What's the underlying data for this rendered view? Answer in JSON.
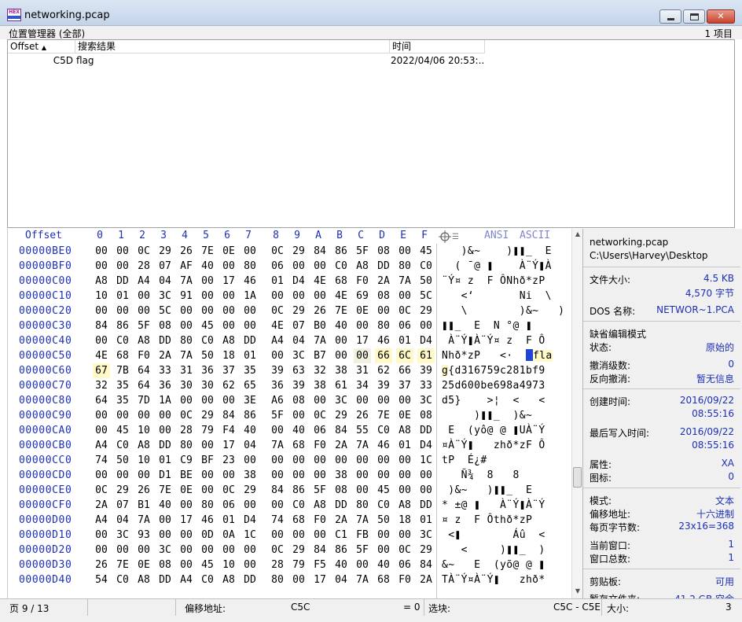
{
  "window": {
    "title": "networking.pcap",
    "icon": "hex-editor-app-icon",
    "icon_text": "HEX"
  },
  "position_manager": {
    "title": "位置管理器 (全部)",
    "count": "1 项目",
    "columns": {
      "offset": "Offset",
      "result": "搜索结果",
      "time": "时间"
    },
    "rows": [
      {
        "offset": "C5D",
        "result": "flag",
        "time": "2022/04/06  20:53:..."
      }
    ]
  },
  "hex": {
    "ruler": {
      "offset_label": "Offset",
      "columns": [
        "0",
        "1",
        "2",
        "3",
        "4",
        "5",
        "6",
        "7",
        "8",
        "9",
        "A",
        "B",
        "C",
        "D",
        "E",
        "F"
      ],
      "ansi": "ANSI",
      "ascii": "ASCII"
    },
    "rows": [
      {
        "off": "00000BE0",
        "bytes": [
          "00",
          "00",
          "0C",
          "29",
          "26",
          "7E",
          "0E",
          "00",
          "0C",
          "29",
          "84",
          "86",
          "5F",
          "08",
          "00",
          "45"
        ],
        "text": "   )&~    )❚❚_  E"
      },
      {
        "off": "00000BF0",
        "bytes": [
          "00",
          "00",
          "28",
          "07",
          "AF",
          "40",
          "00",
          "80",
          "06",
          "00",
          "00",
          "C0",
          "A8",
          "DD",
          "80",
          "C0"
        ],
        "text": "  ( ¯@ ❚    À¨Ý❚À"
      },
      {
        "off": "00000C00",
        "bytes": [
          "A8",
          "DD",
          "A4",
          "04",
          "7A",
          "00",
          "17",
          "46",
          "01",
          "D4",
          "4E",
          "68",
          "F0",
          "2A",
          "7A",
          "50"
        ],
        "text": "¨Ý¤ z  F ÔNhð*zP"
      },
      {
        "off": "00000C10",
        "bytes": [
          "10",
          "01",
          "00",
          "3C",
          "91",
          "00",
          "00",
          "1A",
          "00",
          "00",
          "00",
          "4E",
          "69",
          "08",
          "00",
          "5C"
        ],
        "text": "   <‘       Ni  \\"
      },
      {
        "off": "00000C20",
        "bytes": [
          "00",
          "00",
          "00",
          "5C",
          "00",
          "00",
          "00",
          "00",
          "0C",
          "29",
          "26",
          "7E",
          "0E",
          "00",
          "0C",
          "29"
        ],
        "text": "   \\        )&~   )"
      },
      {
        "off": "00000C30",
        "bytes": [
          "84",
          "86",
          "5F",
          "08",
          "00",
          "45",
          "00",
          "00",
          "4E",
          "07",
          "B0",
          "40",
          "00",
          "80",
          "06",
          "00"
        ],
        "text": "❚❚_  E  N °@ ❚  "
      },
      {
        "off": "00000C40",
        "bytes": [
          "00",
          "C0",
          "A8",
          "DD",
          "80",
          "C0",
          "A8",
          "DD",
          "A4",
          "04",
          "7A",
          "00",
          "17",
          "46",
          "01",
          "D4"
        ],
        "text": " À¨Ý❚À¨Ý¤ z  F Ô"
      },
      {
        "off": "00000C50",
        "bytes": [
          "4E",
          "68",
          "F0",
          "2A",
          "7A",
          "50",
          "18",
          "01",
          "00",
          "3C",
          "B7",
          "00",
          "00",
          "66",
          "6C",
          "61"
        ],
        "text_pre": "Nhð*zP   <·  ",
        "text_cur": " ",
        "text_hl": "fla"
      },
      {
        "off": "00000C60",
        "bytes": [
          "67",
          "7B",
          "64",
          "33",
          "31",
          "36",
          "37",
          "35",
          "39",
          "63",
          "32",
          "38",
          "31",
          "62",
          "66",
          "39"
        ],
        "text_hl_first": "g",
        "text": "{d316759c281bf9"
      },
      {
        "off": "00000C70",
        "bytes": [
          "32",
          "35",
          "64",
          "36",
          "30",
          "30",
          "62",
          "65",
          "36",
          "39",
          "38",
          "61",
          "34",
          "39",
          "37",
          "33"
        ],
        "text": "25d600be698a4973"
      },
      {
        "off": "00000C80",
        "bytes": [
          "64",
          "35",
          "7D",
          "1A",
          "00",
          "00",
          "00",
          "3E",
          "A6",
          "08",
          "00",
          "3C",
          "00",
          "00",
          "00",
          "3C"
        ],
        "text": "d5}    >¦  <   <"
      },
      {
        "off": "00000C90",
        "bytes": [
          "00",
          "00",
          "00",
          "00",
          "0C",
          "29",
          "84",
          "86",
          "5F",
          "00",
          "0C",
          "29",
          "26",
          "7E",
          "0E",
          "08"
        ],
        "text": "     )❚❚_  )&~  "
      },
      {
        "off": "00000CA0",
        "bytes": [
          "00",
          "45",
          "10",
          "00",
          "28",
          "79",
          "F4",
          "40",
          "00",
          "40",
          "06",
          "84",
          "55",
          "C0",
          "A8",
          "DD"
        ],
        "text": " E  (yô@ @ ❚UÀ¨Ý"
      },
      {
        "off": "00000CB0",
        "bytes": [
          "A4",
          "C0",
          "A8",
          "DD",
          "80",
          "00",
          "17",
          "04",
          "7A",
          "68",
          "F0",
          "2A",
          "7A",
          "46",
          "01",
          "D4"
        ],
        "text": "¤À¨Ý❚   zhð*zF Ô"
      },
      {
        "off": "00000CC0",
        "bytes": [
          "74",
          "50",
          "10",
          "01",
          "C9",
          "BF",
          "23",
          "00",
          "00",
          "00",
          "00",
          "00",
          "00",
          "00",
          "00",
          "1C"
        ],
        "text": "tP  É¿#         "
      },
      {
        "off": "00000CD0",
        "bytes": [
          "00",
          "00",
          "00",
          "D1",
          "BE",
          "00",
          "00",
          "38",
          "00",
          "00",
          "00",
          "38",
          "00",
          "00",
          "00",
          "00"
        ],
        "text": "   Ñ¾  8   8    "
      },
      {
        "off": "00000CE0",
        "bytes": [
          "0C",
          "29",
          "26",
          "7E",
          "0E",
          "00",
          "0C",
          "29",
          "84",
          "86",
          "5F",
          "08",
          "00",
          "45",
          "00",
          "00"
        ],
        "text": " )&~   )❚❚_  E  "
      },
      {
        "off": "00000CF0",
        "bytes": [
          "2A",
          "07",
          "B1",
          "40",
          "00",
          "80",
          "06",
          "00",
          "00",
          "C0",
          "A8",
          "DD",
          "80",
          "C0",
          "A8",
          "DD"
        ],
        "text": "* ±@ ❚   À¨Ý❚À¨Ý"
      },
      {
        "off": "00000D00",
        "bytes": [
          "A4",
          "04",
          "7A",
          "00",
          "17",
          "46",
          "01",
          "D4",
          "74",
          "68",
          "F0",
          "2A",
          "7A",
          "50",
          "18",
          "01"
        ],
        "text": "¤ z  F Ôthð*zP  "
      },
      {
        "off": "00000D10",
        "bytes": [
          "00",
          "3C",
          "93",
          "00",
          "00",
          "0D",
          "0A",
          "1C",
          "00",
          "00",
          "00",
          "C1",
          "FB",
          "00",
          "00",
          "3C"
        ],
        "text": " <❚        Áû  <"
      },
      {
        "off": "00000D20",
        "bytes": [
          "00",
          "00",
          "00",
          "3C",
          "00",
          "00",
          "00",
          "00",
          "0C",
          "29",
          "84",
          "86",
          "5F",
          "00",
          "0C",
          "29"
        ],
        "text": "   <     )❚❚_  )"
      },
      {
        "off": "00000D30",
        "bytes": [
          "26",
          "7E",
          "0E",
          "08",
          "00",
          "45",
          "10",
          "00",
          "28",
          "79",
          "F5",
          "40",
          "00",
          "40",
          "06",
          "84"
        ],
        "text": "&~   E  (yõ@ @ ❚"
      },
      {
        "off": "00000D40",
        "bytes": [
          "54",
          "C0",
          "A8",
          "DD",
          "A4",
          "C0",
          "A8",
          "DD",
          "80",
          "00",
          "17",
          "04",
          "7A",
          "68",
          "F0",
          "2A"
        ],
        "text": "TÀ¨Ý¤À¨Ý❚   zhð*"
      }
    ]
  },
  "info": {
    "file_name": "networking.pcap",
    "file_path": "C:\\Users\\Harvey\\Desktop",
    "size_label": "文件大小:",
    "size_kb": "4.5 KB",
    "size_bytes": "4,570 字节",
    "dos_label": "DOS 名称:",
    "dos_value": "NETWOR~1.PCA",
    "edit_mode_title": "缺省编辑模式",
    "state_label": "状态:",
    "state_value": "原始的",
    "undo_label": "撤消级数:",
    "undo_value": "0",
    "redo_label": "反向撤消:",
    "redo_value": "暂无信息",
    "created_label": "创建时间:",
    "created_date": "2016/09/22",
    "created_time": "08:55:16",
    "written_label": "最后写入时间:",
    "written_date": "2016/09/22",
    "written_time": "08:55:16",
    "attr_label": "属性:",
    "attr_value": "XA",
    "icon_label": "图标:",
    "icon_value": "0",
    "mode_label": "模式:",
    "mode_value": "文本",
    "offset_addr_label": "偏移地址:",
    "offset_addr_value": "十六进制",
    "bpp_label": "每页字节数:",
    "bpp_value": "23x16=368",
    "cur_win_label": "当前窗口:",
    "cur_win_value": "1",
    "total_win_label": "窗口总数:",
    "total_win_value": "1",
    "clipboard_label": "剪贴板:",
    "clipboard_value": "可用",
    "temp_label": "暂存文件夹:",
    "temp_value": "41.2 GB 空余"
  },
  "status": {
    "page": "页 9 / 13",
    "offset_label": "偏移地址:",
    "offset_value": "C5C",
    "eq_value": "= 0",
    "block_label": "选块:",
    "block_value": "C5C - C5E",
    "size_label": "大小:",
    "size_value": "3"
  },
  "colors": {
    "offset_blue": "#1c2fb5",
    "highlight": "#fff9c7",
    "cursor": "#2243d8"
  }
}
